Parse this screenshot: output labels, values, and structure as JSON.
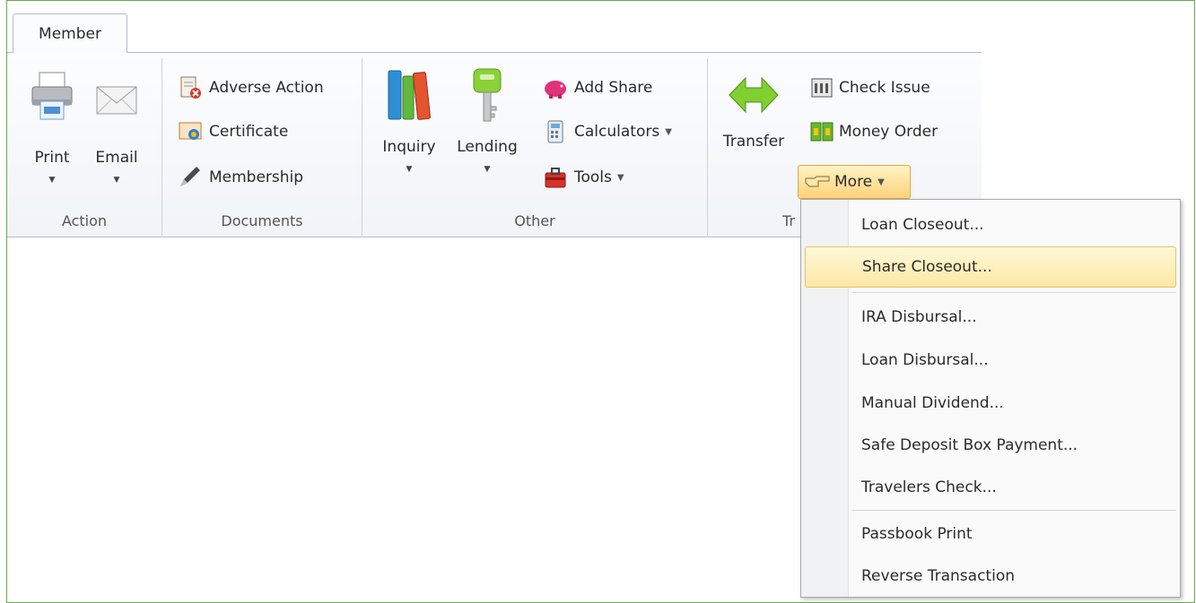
{
  "tab": {
    "label": "Member"
  },
  "groups": {
    "action": {
      "label": "Action",
      "print": "Print",
      "email": "Email"
    },
    "documents": {
      "label": "Documents",
      "adverse_action": "Adverse Action",
      "certificate": "Certificate",
      "membership": "Membership"
    },
    "other": {
      "label": "Other",
      "inquiry": "Inquiry",
      "lending": "Lending",
      "add_share": "Add Share",
      "calculators": "Calculators",
      "tools": "Tools"
    },
    "transactions": {
      "label": "Tr",
      "transfer": "Transfer",
      "check_issue": "Check Issue",
      "money_order": "Money Order",
      "more": "More"
    }
  },
  "menu": {
    "items": [
      "Loan Closeout...",
      "Share Closeout...",
      "IRA Disbursal...",
      "Loan Disbursal...",
      "Manual Dividend...",
      "Safe Deposit Box Payment...",
      "Travelers Check...",
      "Passbook Print",
      "Reverse Transaction"
    ],
    "highlighted_index": 1
  },
  "colors": {
    "frame": "#6aa84f",
    "highlight": "#fde8a6",
    "ribbon": "#f1f4f8"
  }
}
